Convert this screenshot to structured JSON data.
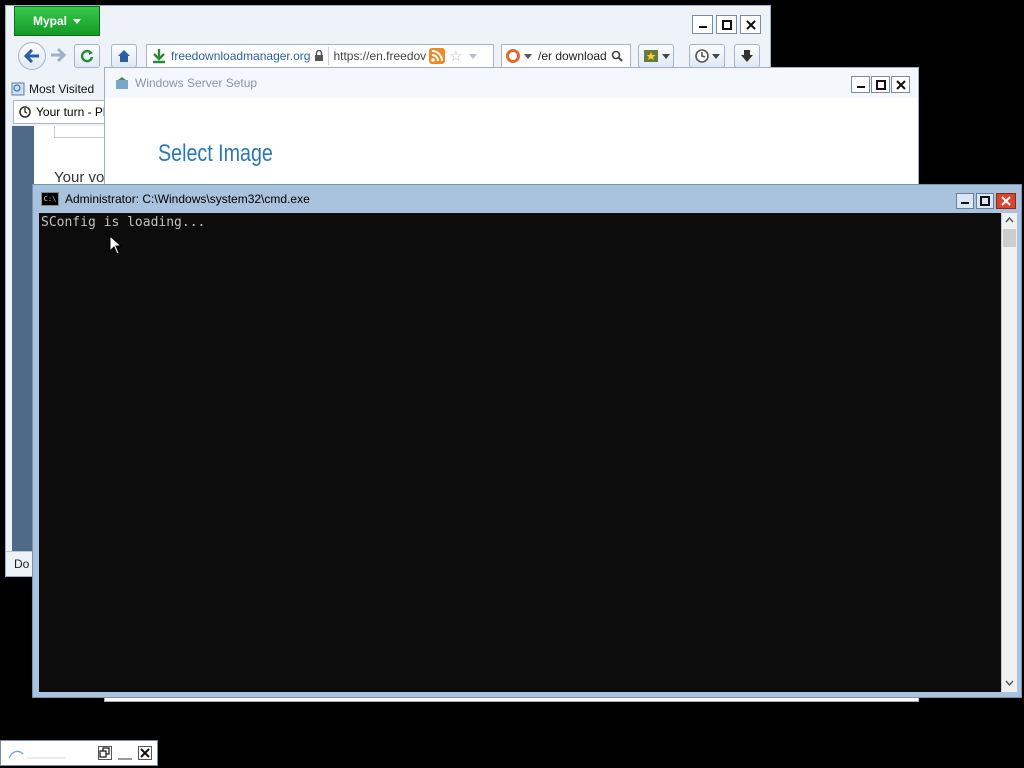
{
  "browser": {
    "app_button": "Mypal",
    "window_buttons": {
      "minimize": "▬",
      "maximize": "■",
      "close": "✕"
    },
    "nav": {
      "back": "⬅",
      "forward": "➡",
      "reload": "↻",
      "home": "⌂"
    },
    "url": {
      "domain": "freedownloadmanager.org",
      "address": "https://en.freedov"
    },
    "search": {
      "text": "/er download"
    },
    "bookmarks": {
      "most_visited": "Most Visited"
    },
    "tab": {
      "title": "Your turn - Pl"
    },
    "content": {
      "text": "Your vo"
    },
    "status": "Do"
  },
  "setup": {
    "title": "Windows Server Setup",
    "heading": "Select Image"
  },
  "cmd": {
    "title": "Administrator: C:\\Windows\\system32\\cmd.exe",
    "icon_text": "C:\\",
    "output": "SConfig is loading..."
  },
  "colors": {
    "cmd_frame": "#a9c2de",
    "console_bg": "#0c0c0c",
    "setup_heading": "#2a78b9",
    "mypal_green": "#1fb532",
    "close_red": "#d9452f"
  }
}
